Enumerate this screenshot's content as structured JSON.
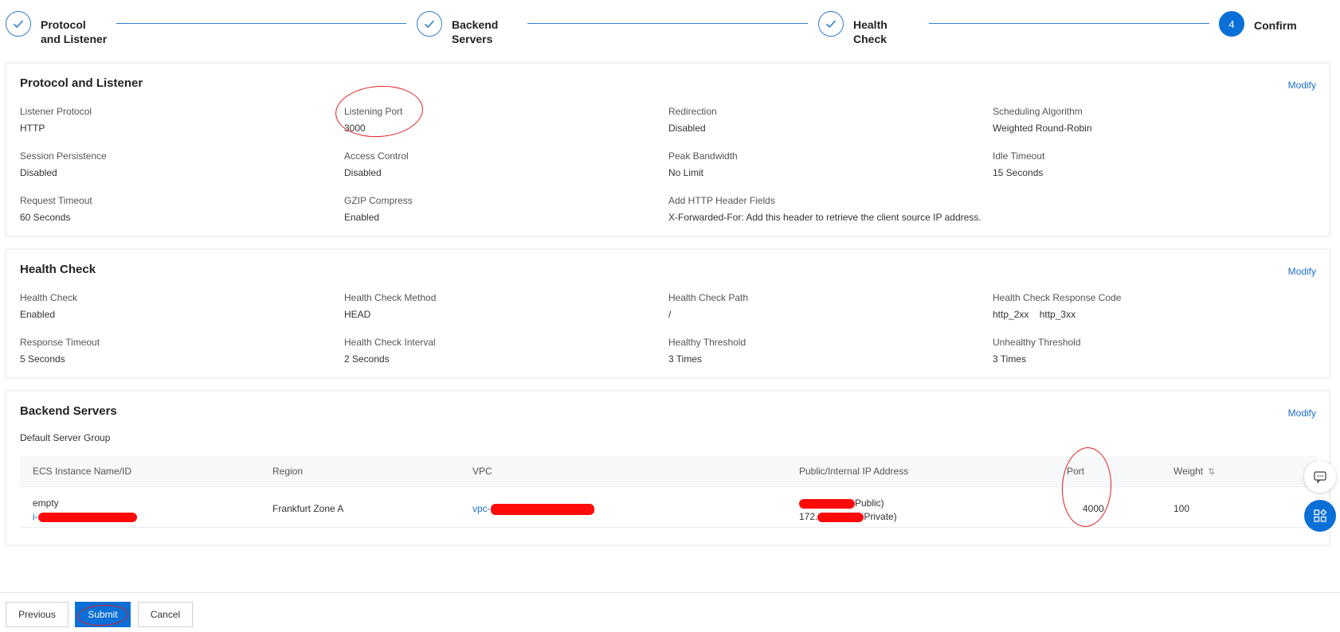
{
  "stepper": {
    "steps": [
      {
        "label": "Protocol and Listener",
        "line1": "Protocol",
        "line2": "and Listener",
        "state": "done"
      },
      {
        "label": "Backend Servers",
        "line1": "Backend",
        "line2": "Servers",
        "state": "done"
      },
      {
        "label": "Health Check",
        "line1": "Health",
        "line2": "Check",
        "state": "done"
      },
      {
        "label": "Confirm",
        "line1": "Confirm",
        "line2": "",
        "number": "4",
        "state": "active"
      }
    ]
  },
  "protocol_card": {
    "title": "Protocol and Listener",
    "modify": "Modify",
    "fields": [
      {
        "label": "Listener Protocol",
        "value": "HTTP"
      },
      {
        "label": "Listening Port",
        "value": "3000"
      },
      {
        "label": "Redirection",
        "value": "Disabled"
      },
      {
        "label": "Scheduling Algorithm",
        "value": "Weighted Round-Robin"
      },
      {
        "label": "Session Persistence",
        "value": "Disabled"
      },
      {
        "label": "Access Control",
        "value": "Disabled"
      },
      {
        "label": "Peak Bandwidth",
        "value": "No Limit"
      },
      {
        "label": "Idle Timeout",
        "value": "15 Seconds"
      },
      {
        "label": "Request Timeout",
        "value": "60 Seconds"
      },
      {
        "label": "GZIP Compress",
        "value": "Enabled"
      },
      {
        "label": "Add HTTP Header Fields",
        "value": "X-Forwarded-For: Add this header to retrieve the client source IP address."
      }
    ]
  },
  "health_card": {
    "title": "Health Check",
    "modify": "Modify",
    "fields": [
      {
        "label": "Health Check",
        "value": "Enabled"
      },
      {
        "label": "Health Check Method",
        "value": "HEAD"
      },
      {
        "label": "Health Check Path",
        "value": "/"
      },
      {
        "label": "Health Check Response Code",
        "value": "http_2xx    http_3xx"
      },
      {
        "label": "Response Timeout",
        "value": "5 Seconds"
      },
      {
        "label": "Health Check Interval",
        "value": "2 Seconds"
      },
      {
        "label": "Healthy Threshold",
        "value": "3 Times"
      },
      {
        "label": "Unhealthy Threshold",
        "value": "3 Times"
      }
    ]
  },
  "backend_card": {
    "title": "Backend Servers",
    "modify": "Modify",
    "group": "Default Server Group",
    "columns": [
      "ECS Instance Name/ID",
      "Region",
      "VPC",
      "Public/Internal IP Address",
      "Port",
      "Weight"
    ],
    "rows": [
      {
        "name": "empty",
        "id_prefix": "i-",
        "region": "Frankfurt Zone A",
        "vpc_prefix": "vpc-",
        "public_suffix": "Public)",
        "private_prefix": "172.",
        "private_suffix": "Private)",
        "port": "4000",
        "weight": "100"
      }
    ]
  },
  "footer": {
    "previous": "Previous",
    "submit": "Submit",
    "cancel": "Cancel"
  },
  "icons": {
    "step_done": "check-icon",
    "sort": "sort-icon",
    "chat": "chat-icon",
    "apps": "apps-grid-icon"
  },
  "colors": {
    "primary": "#0a6fd6",
    "link": "#1a6fcc",
    "annotation": "#e02020",
    "redaction": "#ff0a0a"
  }
}
